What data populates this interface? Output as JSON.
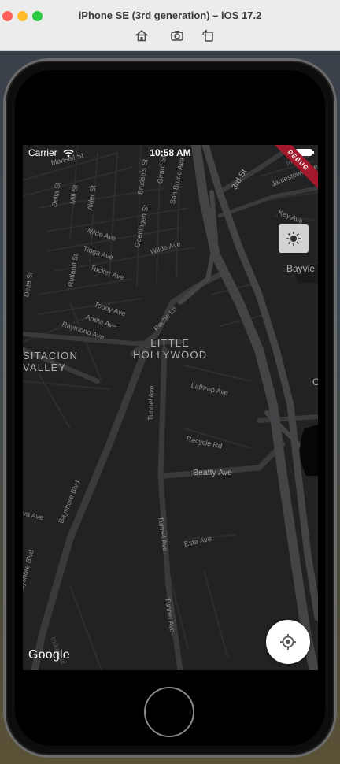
{
  "simulator": {
    "title": "iPhone SE (3rd generation) – iOS 17.2",
    "toolbar": [
      "home-icon",
      "screenshot-icon",
      "rotate-icon"
    ]
  },
  "status_bar": {
    "carrier": "Carrier",
    "time": "10:58 AM"
  },
  "debug_banner": "DEBUG",
  "map": {
    "attribution": "Google",
    "neighborhoods": [
      "LITTLE\nHOLLYWOOD",
      "SITACION\nVALLEY",
      "Bayvie"
    ],
    "streets": {
      "mansell": "Mansell St",
      "san_bruno": "San Bruno Ave",
      "third": "3rd St",
      "delta_top": "Delta St",
      "mill": "Mill St",
      "alder": "Alder St",
      "brussels": "Brussels St",
      "girard": "Girard St",
      "goettingen": "Goettingen St",
      "wilde_west": "Wilde Ave",
      "wilde_east": "Wilde Ave",
      "tioga": "Tioga Ave",
      "tucker": "Tucker Ave",
      "rutland": "Rutland St",
      "delta_left": "Delta St",
      "teddy": "Teddy Ave",
      "arleta": "Arleta Ave",
      "raymond": "Raymond Ave",
      "reche": "Reche Ln",
      "lathrop": "Lathrop Ave",
      "tunnel_1": "Tunnel Ave",
      "tunnel_2": "Tunnel Ave",
      "tunnel_3": "Tunnel Ave",
      "recycle": "Recycle Rd",
      "beatty": "Beatty Ave",
      "esta": "Esta Ave",
      "bayshore_1": "Bayshore Blvd",
      "bayshore_2": "Bayshore Blvd",
      "va_ave": "va Ave",
      "industrial": "Industrial",
      "ingerson": "Ingerso",
      "jamestown": "Jamestown Ave",
      "key": "Key Ave",
      "c_label": "C"
    }
  },
  "controls": {
    "theme_toggle_icon": "sun-icon",
    "locate_icon": "my-location-icon"
  },
  "colors": {
    "map_background": "#222223",
    "road": "#3b3b3d",
    "highway": "#444446",
    "debug_banner": "#a3182a"
  }
}
